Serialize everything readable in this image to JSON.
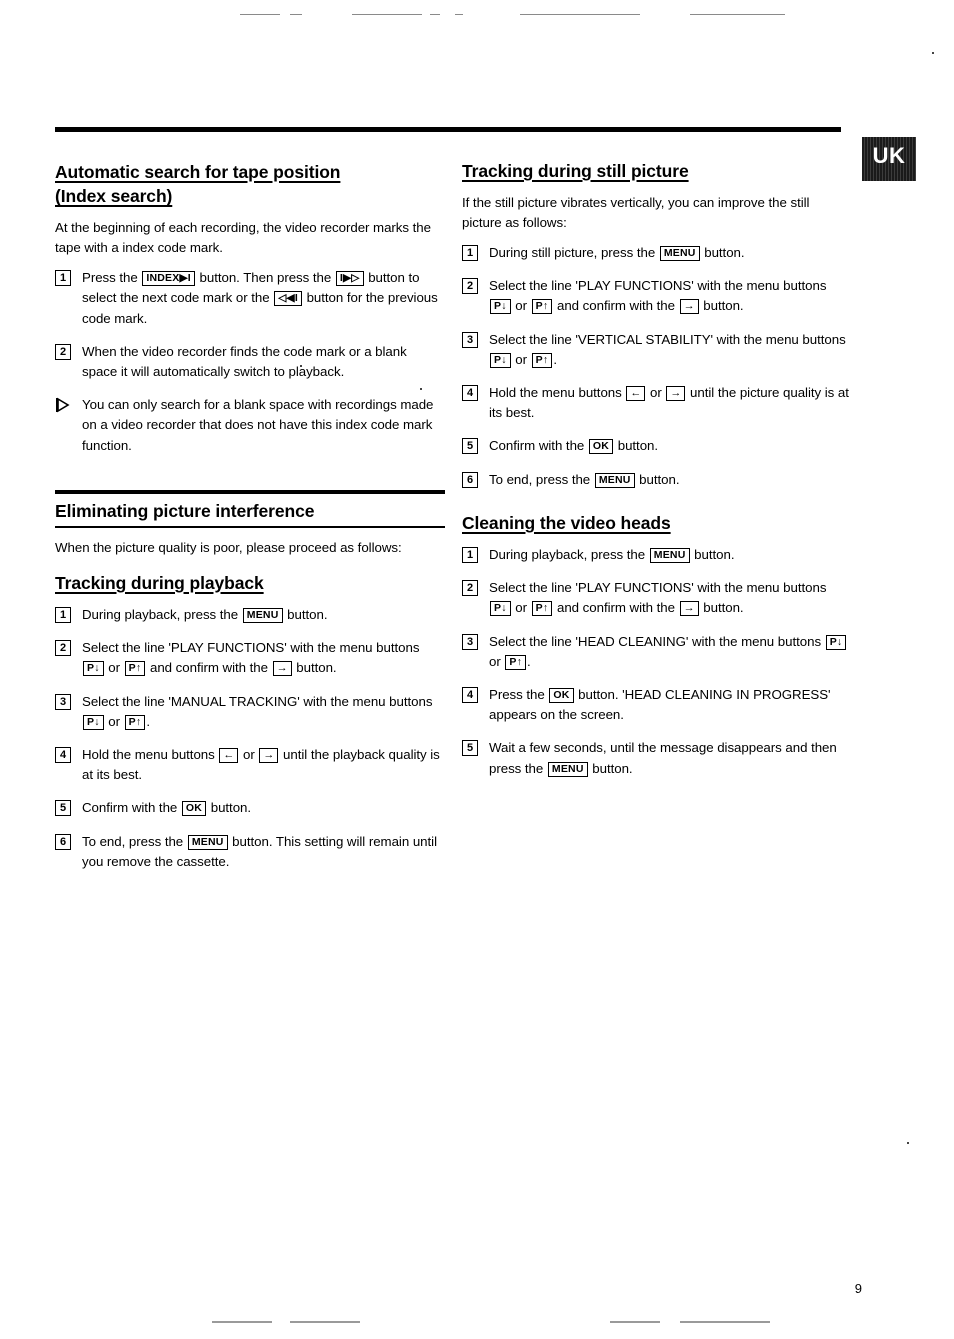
{
  "page": {
    "locale_tab": "UK",
    "page_number": "9"
  },
  "left": {
    "s1": {
      "title_line1": "Automatic search for tape position",
      "title_line2": "(Index search)",
      "intro": "At the beginning of each recording, the video recorder marks the tape with a index code mark.",
      "steps": [
        {
          "num": "1",
          "parts": [
            {
              "t": "text",
              "v": "Press the "
            },
            {
              "t": "key",
              "v": "INDEX▶I"
            },
            {
              "t": "text",
              "v": " button. Then press the "
            },
            {
              "t": "key",
              "v": "I▶▷"
            },
            {
              "t": "text",
              "v": " button to select the next code mark or the "
            },
            {
              "t": "key",
              "v": "◁◀I"
            },
            {
              "t": "text",
              "v": " button for the previous code mark."
            }
          ]
        },
        {
          "num": "2",
          "parts": [
            {
              "t": "text",
              "v": "When the video recorder finds the code mark or a blank space it will automatically switch to playback."
            }
          ]
        },
        {
          "num": "tri",
          "parts": [
            {
              "t": "text",
              "v": "You can only search for a blank space with recordings made on a video recorder that does not have this index code mark function."
            }
          ]
        }
      ]
    },
    "s2": {
      "title": "Eliminating picture interference",
      "intro": "When the picture quality is poor, please proceed as follows:"
    },
    "s3": {
      "title": "Tracking during playback",
      "steps": [
        {
          "num": "1",
          "parts": [
            {
              "t": "text",
              "v": "During playback, press the "
            },
            {
              "t": "key",
              "v": "MENU"
            },
            {
              "t": "text",
              "v": " button."
            }
          ]
        },
        {
          "num": "2",
          "parts": [
            {
              "t": "text",
              "v": "Select the line 'PLAY FUNCTIONS' with the menu buttons "
            },
            {
              "t": "key",
              "v": "P↓"
            },
            {
              "t": "text",
              "v": " or "
            },
            {
              "t": "key",
              "v": "P↑"
            },
            {
              "t": "text",
              "v": " and confirm with the "
            },
            {
              "t": "key",
              "v": "→"
            },
            {
              "t": "text",
              "v": " button."
            }
          ]
        },
        {
          "num": "3",
          "parts": [
            {
              "t": "text",
              "v": "Select the line 'MANUAL TRACKING' with the menu buttons "
            },
            {
              "t": "key",
              "v": "P↓"
            },
            {
              "t": "text",
              "v": " or "
            },
            {
              "t": "key",
              "v": "P↑"
            },
            {
              "t": "text",
              "v": "."
            }
          ]
        },
        {
          "num": "4",
          "parts": [
            {
              "t": "text",
              "v": "Hold the menu buttons "
            },
            {
              "t": "key",
              "v": "←"
            },
            {
              "t": "text",
              "v": " or "
            },
            {
              "t": "key",
              "v": "→"
            },
            {
              "t": "text",
              "v": " until the playback quality is at its best."
            }
          ]
        },
        {
          "num": "5",
          "parts": [
            {
              "t": "text",
              "v": "Confirm with the "
            },
            {
              "t": "key",
              "v": "OK"
            },
            {
              "t": "text",
              "v": " button."
            }
          ]
        },
        {
          "num": "6",
          "parts": [
            {
              "t": "text",
              "v": "To end, press the "
            },
            {
              "t": "key",
              "v": "MENU"
            },
            {
              "t": "text",
              "v": " button. This setting will remain until you remove the cassette."
            }
          ]
        }
      ]
    }
  },
  "right": {
    "s1": {
      "title": "Tracking during still picture",
      "intro": "If the still picture vibrates vertically, you can improve the still picture as follows:",
      "steps": [
        {
          "num": "1",
          "parts": [
            {
              "t": "text",
              "v": "During still picture, press the "
            },
            {
              "t": "key",
              "v": "MENU"
            },
            {
              "t": "text",
              "v": " button."
            }
          ]
        },
        {
          "num": "2",
          "parts": [
            {
              "t": "text",
              "v": "Select the line 'PLAY FUNCTIONS' with the menu buttons "
            },
            {
              "t": "key",
              "v": "P↓"
            },
            {
              "t": "text",
              "v": " or "
            },
            {
              "t": "key",
              "v": "P↑"
            },
            {
              "t": "text",
              "v": " and confirm with the "
            },
            {
              "t": "key",
              "v": "→"
            },
            {
              "t": "text",
              "v": " button."
            }
          ]
        },
        {
          "num": "3",
          "parts": [
            {
              "t": "text",
              "v": "Select the line 'VERTICAL STABILITY' with the menu buttons "
            },
            {
              "t": "key",
              "v": "P↓"
            },
            {
              "t": "text",
              "v": " or "
            },
            {
              "t": "key",
              "v": "P↑"
            },
            {
              "t": "text",
              "v": "."
            }
          ]
        },
        {
          "num": "4",
          "parts": [
            {
              "t": "text",
              "v": "Hold the menu buttons "
            },
            {
              "t": "key",
              "v": "←"
            },
            {
              "t": "text",
              "v": " or "
            },
            {
              "t": "key",
              "v": "→"
            },
            {
              "t": "text",
              "v": " until the picture quality is at its best."
            }
          ]
        },
        {
          "num": "5",
          "parts": [
            {
              "t": "text",
              "v": "Confirm with the "
            },
            {
              "t": "key",
              "v": "OK"
            },
            {
              "t": "text",
              "v": " button."
            }
          ]
        },
        {
          "num": "6",
          "parts": [
            {
              "t": "text",
              "v": "To end, press the "
            },
            {
              "t": "key",
              "v": "MENU"
            },
            {
              "t": "text",
              "v": " button."
            }
          ]
        }
      ]
    },
    "s2": {
      "title": "Cleaning the video heads",
      "steps": [
        {
          "num": "1",
          "parts": [
            {
              "t": "text",
              "v": "During playback, press the "
            },
            {
              "t": "key",
              "v": "MENU"
            },
            {
              "t": "text",
              "v": " button."
            }
          ]
        },
        {
          "num": "2",
          "parts": [
            {
              "t": "text",
              "v": "Select the line 'PLAY FUNCTIONS' with the menu buttons "
            },
            {
              "t": "key",
              "v": "P↓"
            },
            {
              "t": "text",
              "v": " or "
            },
            {
              "t": "key",
              "v": "P↑"
            },
            {
              "t": "text",
              "v": " and confirm with the "
            },
            {
              "t": "key",
              "v": "→"
            },
            {
              "t": "text",
              "v": " button."
            }
          ]
        },
        {
          "num": "3",
          "parts": [
            {
              "t": "text",
              "v": "Select the line 'HEAD CLEANING' with the menu buttons "
            },
            {
              "t": "key",
              "v": "P↓"
            },
            {
              "t": "text",
              "v": " or "
            },
            {
              "t": "key",
              "v": "P↑"
            },
            {
              "t": "text",
              "v": "."
            }
          ]
        },
        {
          "num": "4",
          "parts": [
            {
              "t": "text",
              "v": "Press the "
            },
            {
              "t": "key",
              "v": "OK"
            },
            {
              "t": "text",
              "v": " button. 'HEAD CLEANING IN PROGRESS' appears on the screen."
            }
          ]
        },
        {
          "num": "5",
          "parts": [
            {
              "t": "text",
              "v": "Wait a few seconds, until the message disappears and then press the "
            },
            {
              "t": "key",
              "v": "MENU"
            },
            {
              "t": "text",
              "v": " button."
            }
          ]
        }
      ]
    }
  }
}
